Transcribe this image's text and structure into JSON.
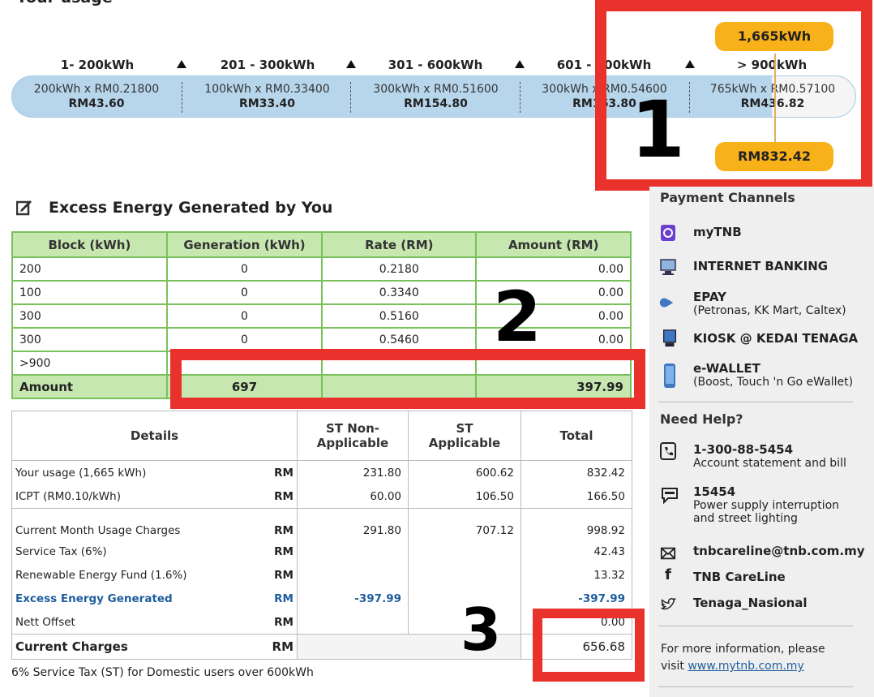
{
  "page": {
    "top_title_fragment": "Your usage"
  },
  "tiers": [
    {
      "range": "1- 200kWh",
      "calc": "200kWh x RM0.21800",
      "amount": "RM43.60"
    },
    {
      "range": "201 - 300kWh",
      "calc": "100kWh x RM0.33400",
      "amount": "RM33.40"
    },
    {
      "range": "301 - 600kWh",
      "calc": "300kWh x RM0.51600",
      "amount": "RM154.80"
    },
    {
      "range": "601 - 900kWh",
      "calc": "300kWh x RM0.54600",
      "amount": "RM163.80"
    },
    {
      "range": "> 900kWh",
      "calc": "765kWh x RM0.57100",
      "amount": "RM436.82"
    }
  ],
  "total_usage": "1,665kWh",
  "total_amount": "RM832.42",
  "callouts": [
    "1",
    "2",
    "3"
  ],
  "excess": {
    "title": "Excess Energy Generated by You",
    "headers": [
      "Block (kWh)",
      "Generation (kWh)",
      "Rate (RM)",
      "Amount (RM)"
    ],
    "rows": [
      [
        "200",
        "0",
        "0.2180",
        "0.00"
      ],
      [
        "100",
        "0",
        "0.3340",
        "0.00"
      ],
      [
        "300",
        "0",
        "0.5160",
        "0.00"
      ],
      [
        "300",
        "0",
        "0.5460",
        "0.00"
      ],
      [
        ">900",
        "",
        "",
        ""
      ]
    ],
    "amount_row": [
      "Amount",
      "697",
      "",
      "397.99"
    ]
  },
  "details": {
    "headers": [
      "Details",
      "ST Non-\nApplicable",
      "ST\nApplicable",
      "Total"
    ],
    "rows": [
      {
        "label": "Your usage (1,665 kWh)",
        "cur": "RM",
        "non": "231.80",
        "app": "600.62",
        "total": "832.42"
      },
      {
        "label": "ICPT (RM0.10/kWh)",
        "cur": "RM",
        "non": "60.00",
        "app": "106.50",
        "total": "166.50"
      },
      {
        "label": "Current Month Usage Charges",
        "cur": "RM",
        "non": "291.80",
        "app": "707.12",
        "total": "998.92"
      },
      {
        "label": "Service Tax (6%)",
        "cur": "RM",
        "non": "",
        "app": "",
        "total": "42.43"
      },
      {
        "label": "Renewable Energy Fund (1.6%)",
        "cur": "RM",
        "non": "",
        "app": "",
        "total": "13.32"
      },
      {
        "label": "Excess Energy Generated",
        "cur": "RM",
        "non": "-397.99",
        "app": "",
        "total": "-397.99"
      },
      {
        "label": "Nett Offset",
        "cur": "RM",
        "non": "",
        "app": "",
        "total": "0.00"
      }
    ],
    "current": {
      "label": "Current Charges",
      "cur": "RM",
      "total": "656.68"
    },
    "note": "6% Service Tax (ST) for Domestic users over 600kWh"
  },
  "payment": {
    "title": "Payment Channels",
    "items": [
      {
        "label": "myTNB",
        "sub": ""
      },
      {
        "label": "INTERNET BANKING",
        "sub": ""
      },
      {
        "label": "EPAY",
        "sub": "(Petronas, KK Mart, Caltex)"
      },
      {
        "label": "KIOSK @ KEDAI TENAGA",
        "sub": ""
      },
      {
        "label": "e-WALLET",
        "sub": "(Boost, Touch 'n Go eWallet)"
      }
    ]
  },
  "help": {
    "title": "Need Help?",
    "phone": {
      "label": "1-300-88-5454",
      "sub": "Account statement and bill"
    },
    "sms": {
      "label": "15454",
      "sub1": "Power supply interruption",
      "sub2": "and street lighting"
    },
    "email": "tnbcareline@tnb.com.my",
    "facebook": "TNB CareLine",
    "twitter": "Tenaga_Nasional",
    "more1": "For more information, please",
    "more_visit": "visit ",
    "more_link": "www.mytnb.com.my"
  },
  "colors": {
    "tier_bar": "#b7d6ec",
    "pill": "#f8b118",
    "table_green": "#c7e7b0",
    "highlight_red": "#e8322b",
    "link_blue": "#1f5e9e"
  }
}
